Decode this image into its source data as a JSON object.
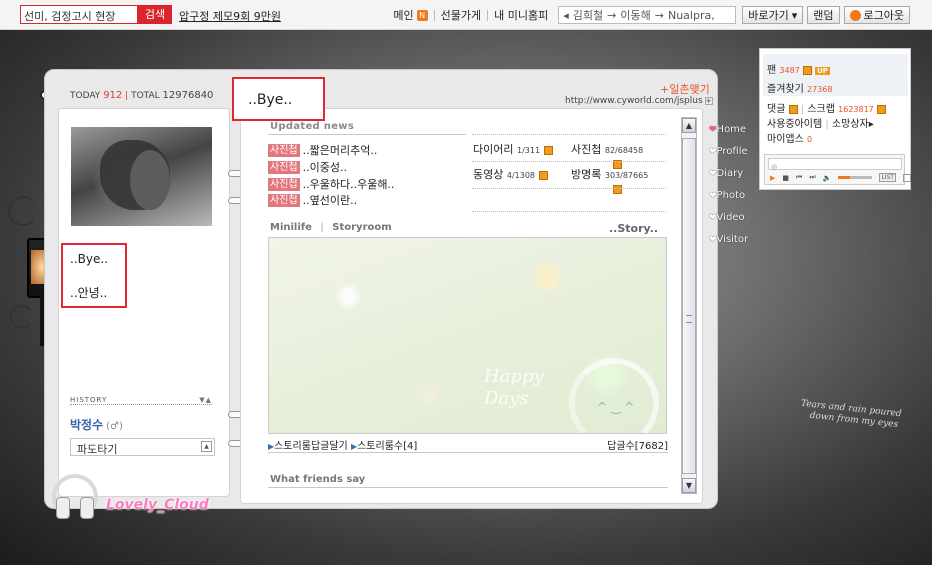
{
  "topbar": {
    "search_value": "선미, 검정고시 현장",
    "search_button": "검색",
    "promo": "압구정 제모9회 9만원",
    "main_label": "메인",
    "main_badge": "N",
    "gift_shop": "선물가게",
    "my_minihompy": "내 미니홈피",
    "path_1": "김희철",
    "path_2": "이동해",
    "path_3": "Nualpra,",
    "shortcut": "바로가기",
    "random": "랜덤",
    "logout": "로그아웃"
  },
  "counter": {
    "today_label": "TODAY",
    "today_value": "912",
    "total_label": "TOTAL",
    "total_value": "12976840"
  },
  "profile": {
    "status_line1": "..Bye..",
    "status_line2": "..안녕..",
    "history_label": "HISTORY",
    "name": "박정수",
    "name_icon": "(♂)",
    "mood": "파도타기"
  },
  "home": {
    "title": "..Bye..",
    "ilchon_button": "일촌맺기",
    "url": "http://www.cyworld.com/jsplus",
    "updated_news_heading": "Updated news",
    "news": [
      {
        "tag": "사진첩",
        "text": "..짧은머리추억.."
      },
      {
        "tag": "사진첩",
        "text": "..이중성.."
      },
      {
        "tag": "사진첩",
        "text": "..우울하다..우울해.."
      },
      {
        "tag": "사진첩",
        "text": "..옆선이란.."
      }
    ],
    "stats": [
      {
        "label": "다이어리",
        "count": "1/311"
      },
      {
        "label": "사진첩",
        "count": "82/68458"
      },
      {
        "label": "동영상",
        "count": "4/1308"
      },
      {
        "label": "방명록",
        "count": "303/87665"
      }
    ],
    "minilife_label": "Minilife",
    "storyroom_label": "Storyroom",
    "story_label": "..Story..",
    "room_text_1": "Happy",
    "room_text_2": "Days",
    "room_smile": "^ ‿ ^",
    "reply_label": "스토리룸답글달기",
    "story_count_label": "스토리룸수[4]",
    "reply_count": "답글수[7682]",
    "friends_heading": "What friends say"
  },
  "menu": [
    {
      "label": "Home"
    },
    {
      "label": "Profile"
    },
    {
      "label": "Diary"
    },
    {
      "label": "Photo"
    },
    {
      "label": "Video"
    },
    {
      "label": "Visitor"
    }
  ],
  "sidebox": {
    "fan_label": "팬",
    "fan_count": "3487",
    "up_badge": "UP",
    "favorites_label": "즐겨찾기",
    "favorites_count": "27368",
    "reply_label": "댓글",
    "scrap_label": "스크랩",
    "scrap_count": "1623817",
    "items_label": "사용중아이템",
    "wish_label": "소망상자",
    "myapps_label": "마이앱스",
    "myapps_count": "0",
    "player_list": "LIST"
  },
  "decor": {
    "signature": "Lovely_Cloud",
    "rain_text_1": "Tears and rain poured",
    "rain_text_2": "down from my eyes"
  },
  "colors": {
    "accent_red": "#d9252b",
    "news_tag": "#e2787c",
    "orange": "#f07a1b",
    "link_blue": "#3864a8"
  }
}
